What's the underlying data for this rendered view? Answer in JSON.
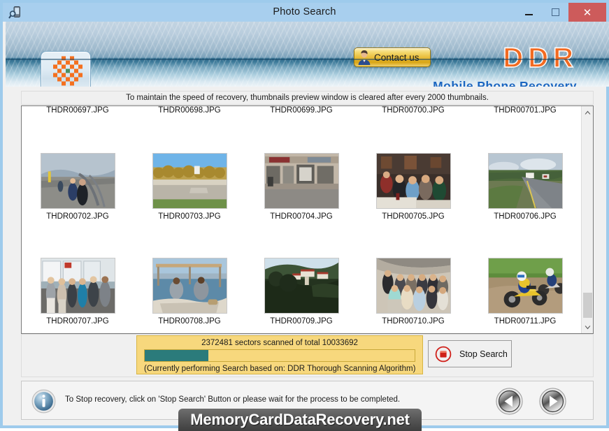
{
  "window": {
    "title": "Photo Search",
    "icon": "phone-search-icon",
    "minimize_label": "–",
    "maximize_label": "□",
    "close_label": "✕"
  },
  "header": {
    "logo_tile_icon": "ddr-checker-flower-icon",
    "contact_button": {
      "label": "Contact us",
      "icon": "person-avatar-icon"
    },
    "brand": "DDR",
    "brand_subtitle": "Mobile Phone Recovery",
    "brand_color": "#f26a21",
    "subtitle_color": "#1b66c0"
  },
  "notice": {
    "text": "To maintain the speed of recovery, thumbnails preview window is cleared after every 2000 thumbnails."
  },
  "thumbnails": {
    "row0_captions": [
      "THDR00697.JPG",
      "THDR00698.JPG",
      "THDR00699.JPG",
      "THDR00700.JPG",
      "THDR00701.JPG"
    ],
    "items": [
      {
        "caption": "THDR00702.JPG",
        "description": "cyclists on waterfront promenade under cloudy sky"
      },
      {
        "caption": "THDR00703.JPG",
        "description": "autumn trees along a parking lot under blue sky"
      },
      {
        "caption": "THDR00704.JPG",
        "description": "storefront strip mall exterior"
      },
      {
        "caption": "THDR00705.JPG",
        "description": "people seated at banquet tables indoors"
      },
      {
        "caption": "THDR00706.JPG",
        "description": "country road curving past farm houses"
      },
      {
        "caption": "THDR00707.JPG",
        "description": "group of people standing in front of poster boards"
      },
      {
        "caption": "THDR00708.JPG",
        "description": "two men sitting in a boat on the water"
      },
      {
        "caption": "THDR00709.JPG",
        "description": "hillside resort buildings among trees"
      },
      {
        "caption": "THDR00710.JPG",
        "description": "group photo of people by a stone wall"
      },
      {
        "caption": "THDR00711.JPG",
        "description": "two motocross riders racing on dirt track"
      }
    ],
    "scrollbar": {
      "up_arrow": "chevron-up-icon",
      "down_arrow": "chevron-down-icon"
    }
  },
  "progress": {
    "status_text": "2372481 sectors scanned of total 10033692",
    "scanned_sectors": 2372481,
    "total_sectors": 10033692,
    "percent": 23.6,
    "fill_color": "#2b7b7b",
    "panel_color": "#f7d87d",
    "note": "(Currently performing Search based on:  DDR Thorough Scanning Algorithm)"
  },
  "stop_button": {
    "label": "Stop Search",
    "icon": "stop-record-icon"
  },
  "footer": {
    "icon": "info-icon",
    "message": "To Stop recovery, click on 'Stop Search' Button or please wait for the process to be completed.",
    "prev_button_icon": "arrow-left-icon",
    "next_button_icon": "arrow-right-icon"
  },
  "watermark": {
    "text": "MemoryCardDataRecovery.net"
  }
}
